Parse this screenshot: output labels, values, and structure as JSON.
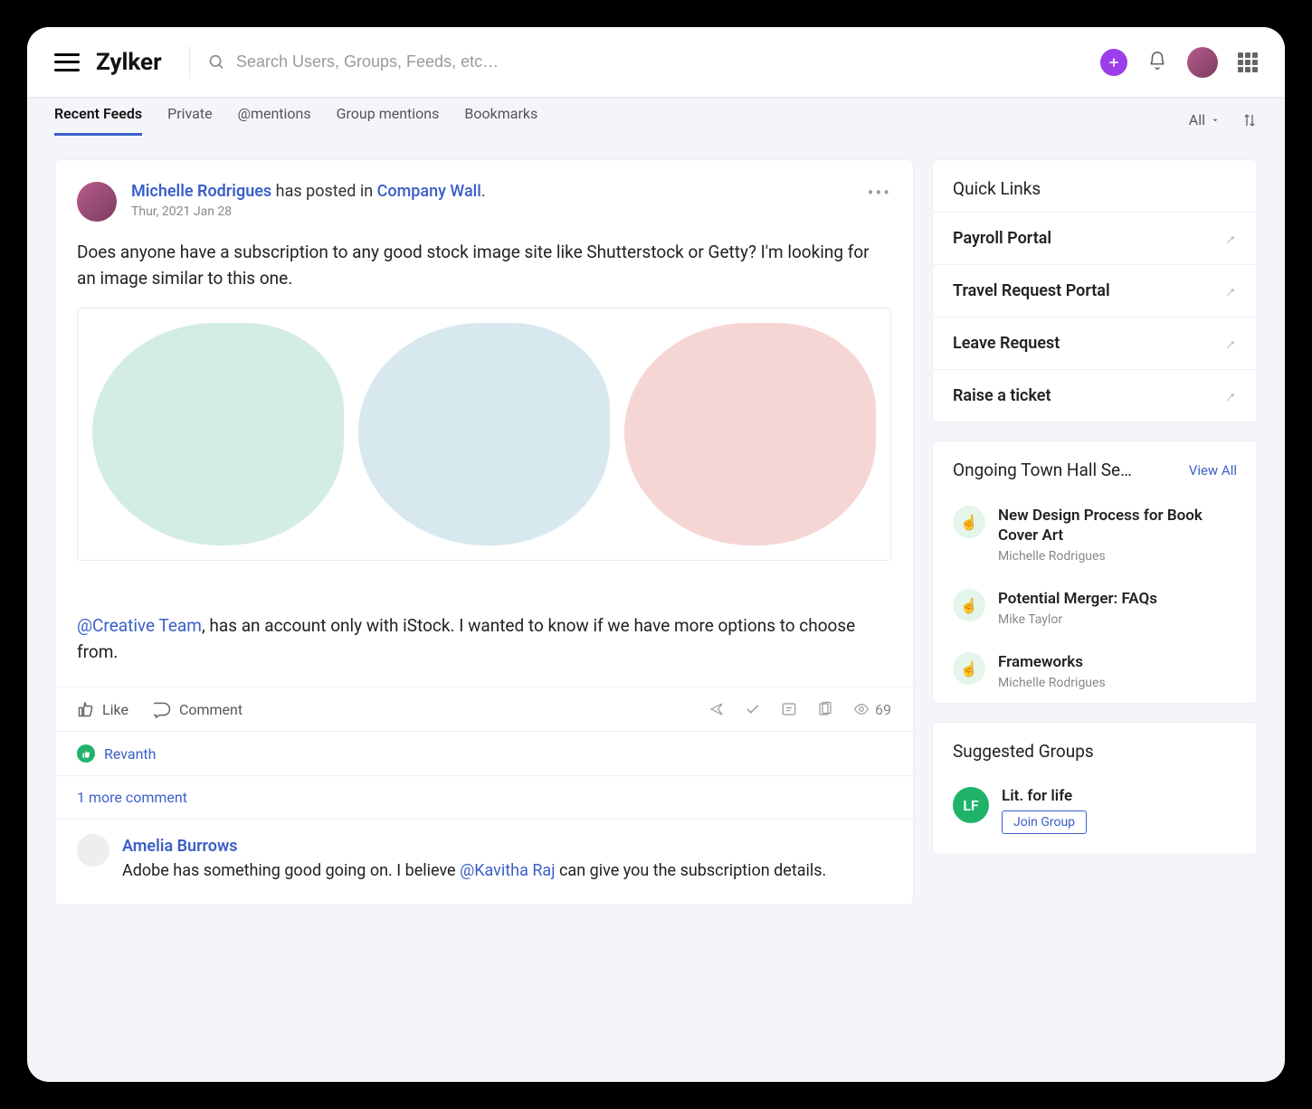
{
  "brand": "Zylker",
  "search": {
    "placeholder": "Search Users, Groups, Feeds, etc…"
  },
  "tabs": {
    "items": [
      "Recent Feeds",
      "Private",
      "@mentions",
      "Group mentions",
      "Bookmarks"
    ],
    "active": 0,
    "filter": "All"
  },
  "post": {
    "author": "Michelle Rodrigues",
    "verb": " has posted in ",
    "where": "Company Wall",
    "date": "Thur, 2021 Jan 28",
    "body": "Does anyone have a subscription to any good stock image site like Shutterstock or Getty? I'm looking for an image similar to this one.",
    "followup_mention": "@Creative Team",
    "followup_rest": ", has an account only with iStock. I wanted to know if we have more options to choose from.",
    "actions": {
      "like": "Like",
      "comment": "Comment",
      "views": "69"
    },
    "liker": "Revanth",
    "more_comments": "1 more comment",
    "comment": {
      "author": "Amelia Burrows",
      "text_before": "Adobe has something good going on. I believe ",
      "mention": "@Kavitha Raj",
      "text_after": " can give you the subscription details."
    }
  },
  "quicklinks": {
    "title": "Quick Links",
    "items": [
      "Payroll Portal",
      "Travel Request Portal",
      "Leave Request",
      "Raise a ticket"
    ]
  },
  "sessions": {
    "title": "Ongoing Town Hall Se…",
    "view_all": "View All",
    "items": [
      {
        "title": "New Design Process for Book Cover Art",
        "by": "Michelle Rodrigues"
      },
      {
        "title": "Potential Merger: FAQs",
        "by": "Mike Taylor"
      },
      {
        "title": "Frameworks",
        "by": "Michelle Rodrigues"
      }
    ]
  },
  "groups": {
    "title": "Suggested Groups",
    "items": [
      {
        "initials": "LF",
        "name": "Lit. for life",
        "cta": "Join Group"
      }
    ]
  }
}
